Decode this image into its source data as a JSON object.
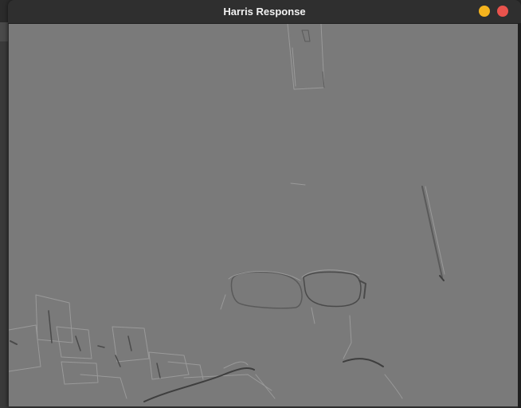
{
  "window": {
    "title": "Harris Response",
    "minimize_color": "#f5b41e",
    "close_color": "#e9534d"
  },
  "image": {
    "background_color": "#7a7a7a",
    "edge_light_color": "#9a9a9a",
    "edge_dark_color": "#4a4a4a"
  }
}
